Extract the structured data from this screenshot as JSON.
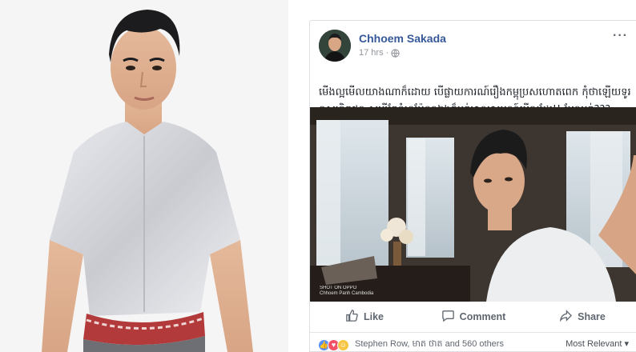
{
  "post": {
    "author": "Chhoem Sakada",
    "time": "17 hrs",
    "separator": "·",
    "text": "មើងល្អមើលយាងណាក៏ដោយ បើផ្លាយការណ៍រឿងកម្ពុប្រសហោតពេក កុំថាឡើយទូរទស្សនិកជន សូម្បីតែខ្ញុំហម៉ែខ្លួនឯងក៏អត់មានអារម្មណ៍មើលដែរ!! មែនអត់???",
    "media_watermark": "SHOT ON OPPO\nChhoem Panh Cambodia",
    "more_label": "···"
  },
  "actions": {
    "like": "Like",
    "comment": "Comment",
    "share": "Share"
  },
  "reactions": {
    "summary": "Stephen Row, មាត ថាត and 560 others",
    "sort_label": "Most Relevant ▾"
  },
  "icons": {
    "globe": "globe-icon",
    "like": "thumbs-up-icon",
    "comment": "speech-bubble-icon",
    "share": "share-arrow-icon"
  },
  "colors": {
    "author_link": "#365899",
    "like_reaction": "#5890ff",
    "love_reaction": "#f25268",
    "haha_reaction": "#f7c544"
  }
}
